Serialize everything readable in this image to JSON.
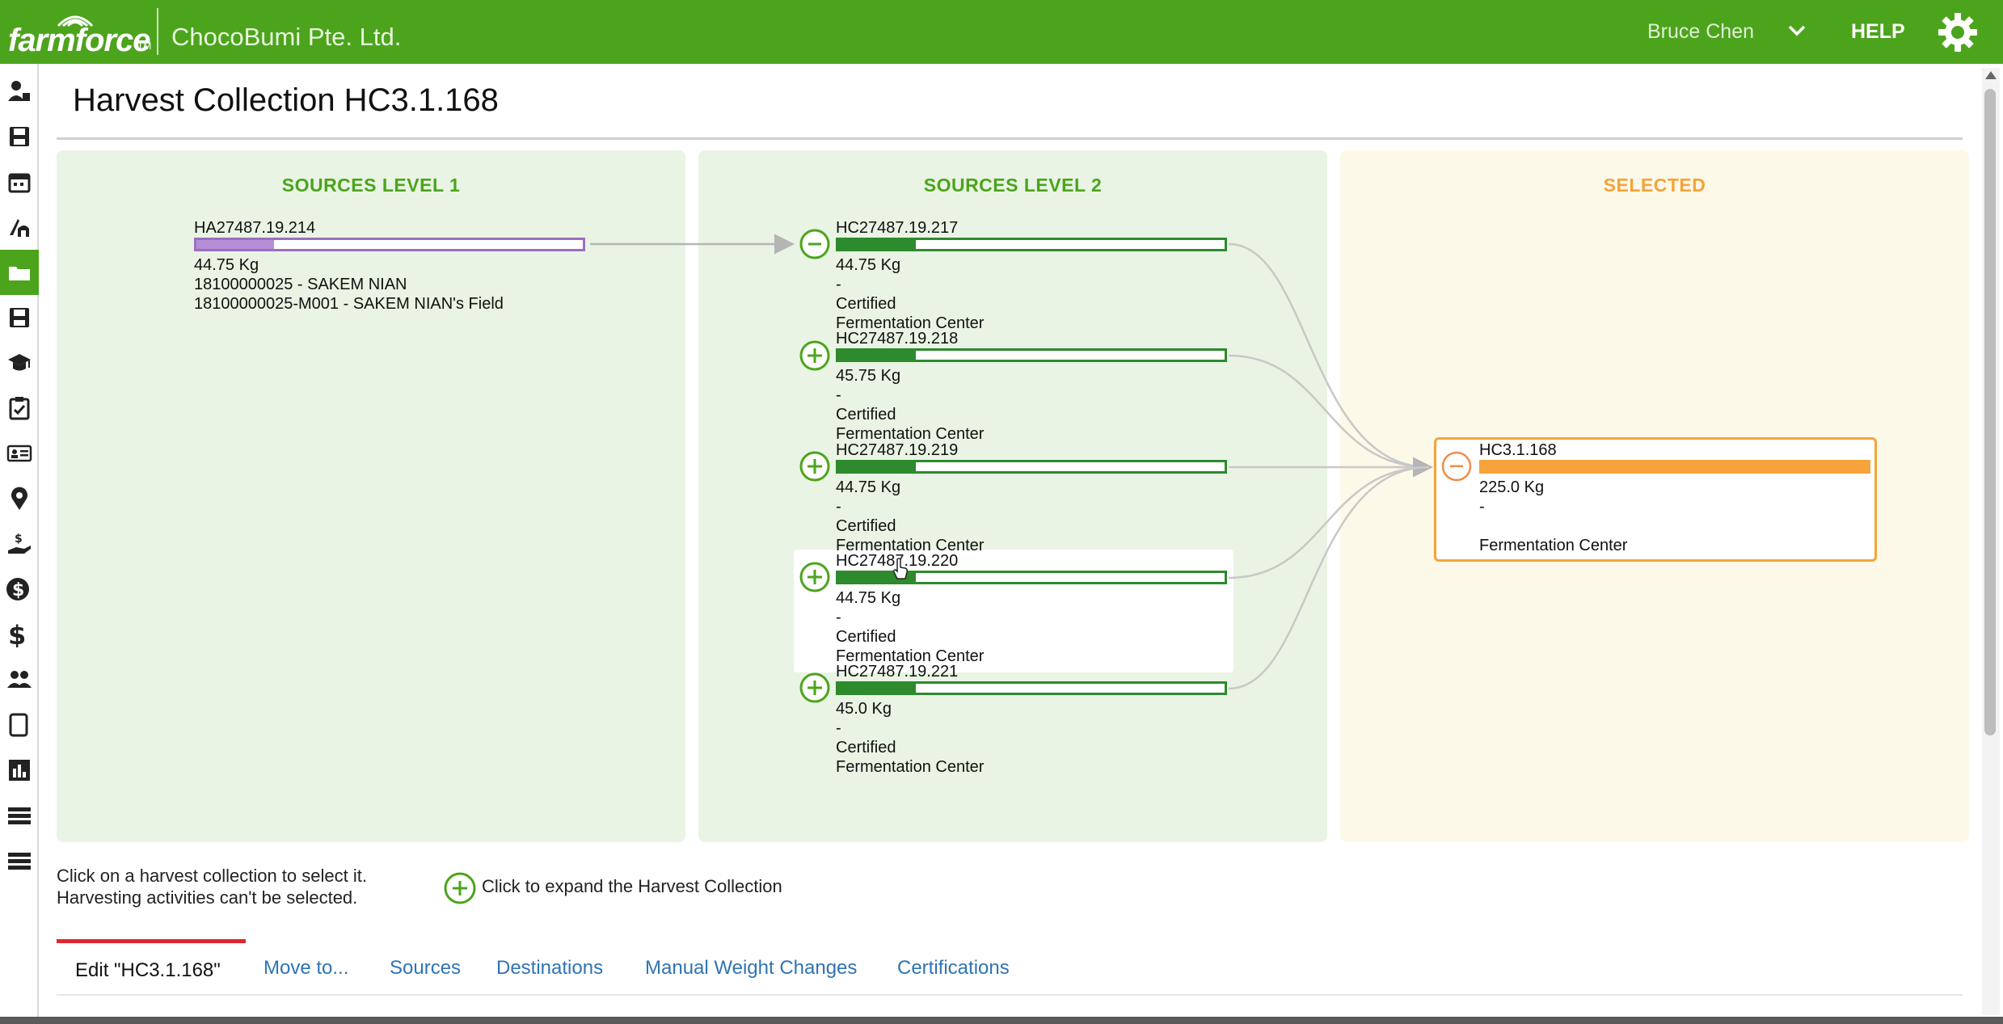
{
  "header": {
    "logo_text": "farmforce",
    "logo_tm": "TM",
    "company": "ChocoBumi Pte. Ltd.",
    "user": "Bruce Chen",
    "help": "HELP"
  },
  "sidebar": {
    "items": [
      {
        "icon": "farmer-icon",
        "active": false
      },
      {
        "icon": "save-icon",
        "active": false
      },
      {
        "icon": "calendar-icon",
        "active": false
      },
      {
        "icon": "harvest-icon",
        "active": false
      },
      {
        "icon": "collection-folder-icon",
        "active": true
      },
      {
        "icon": "storage-icon",
        "active": false
      },
      {
        "icon": "training-icon",
        "active": false
      },
      {
        "icon": "checklist-icon",
        "active": false
      },
      {
        "icon": "id-card-icon",
        "active": false
      },
      {
        "icon": "map-pin-icon",
        "active": false
      },
      {
        "icon": "payment-hand-icon",
        "active": false
      },
      {
        "icon": "dollar-circle-icon",
        "active": false
      },
      {
        "icon": "dollar-icon",
        "active": false
      },
      {
        "icon": "group-icon",
        "active": false
      },
      {
        "icon": "tablet-icon",
        "active": false
      },
      {
        "icon": "bar-chart-icon",
        "active": false
      },
      {
        "icon": "list-icon",
        "active": false
      },
      {
        "icon": "menu-icon",
        "active": false
      }
    ]
  },
  "page": {
    "title": "Harvest Collection HC3.1.168"
  },
  "panels": {
    "level1": {
      "heading": "SOURCES LEVEL 1",
      "node": {
        "id": "HA27487.19.214",
        "fill_fraction": 0.2,
        "weight": "44.75 Kg",
        "farmer": "18100000025 - SAKEM NIAN",
        "field": "18100000025-M001 - SAKEM NIAN's Field"
      }
    },
    "level2": {
      "heading": "SOURCES LEVEL 2",
      "nodes": [
        {
          "id": "HC27487.19.217",
          "fill_fraction": 0.2,
          "weight": "44.75 Kg",
          "dash": "-",
          "cert": "Certified",
          "center": "Fermentation Center",
          "toggle": "collapse"
        },
        {
          "id": "HC27487.19.218",
          "fill_fraction": 0.2,
          "weight": "45.75 Kg",
          "dash": "-",
          "cert": "Certified",
          "center": "Fermentation Center",
          "toggle": "expand"
        },
        {
          "id": "HC27487.19.219",
          "fill_fraction": 0.2,
          "weight": "44.75 Kg",
          "dash": "-",
          "cert": "Certified",
          "center": "Fermentation Center",
          "toggle": "expand"
        },
        {
          "id": "HC27487.19.220",
          "fill_fraction": 0.2,
          "weight": "44.75 Kg",
          "dash": "-",
          "cert": "Certified",
          "center": "Fermentation Center",
          "toggle": "expand"
        },
        {
          "id": "HC27487.19.221",
          "fill_fraction": 0.2,
          "weight": "45.0 Kg",
          "dash": "-",
          "cert": "Certified",
          "center": "Fermentation Center",
          "toggle": "expand"
        }
      ]
    },
    "selected": {
      "heading": "SELECTED",
      "node": {
        "id": "HC3.1.168",
        "fill_fraction": 1.0,
        "weight": "225.0 Kg",
        "dash": "-",
        "center": "Fermentation Center"
      }
    }
  },
  "hints": {
    "line1": "Click on a harvest collection to select it.",
    "line2": "Harvesting activities can't be selected.",
    "expand": "Click to expand the Harvest Collection"
  },
  "tabs": [
    {
      "label": "Edit \"HC3.1.168\"",
      "active": true
    },
    {
      "label": "Move to...",
      "active": false
    },
    {
      "label": "Sources",
      "active": false
    },
    {
      "label": "Destinations",
      "active": false
    },
    {
      "label": "Manual Weight Changes",
      "active": false
    },
    {
      "label": "Certifications",
      "active": false
    }
  ],
  "colors": {
    "brand_green": "#4ca41c",
    "bar_green": "#2d8a2d",
    "selected_orange": "#f5a33a",
    "level1_purple": "#9b6fc0",
    "tab_active_red": "#e0262e",
    "link_blue": "#2f74b5"
  }
}
